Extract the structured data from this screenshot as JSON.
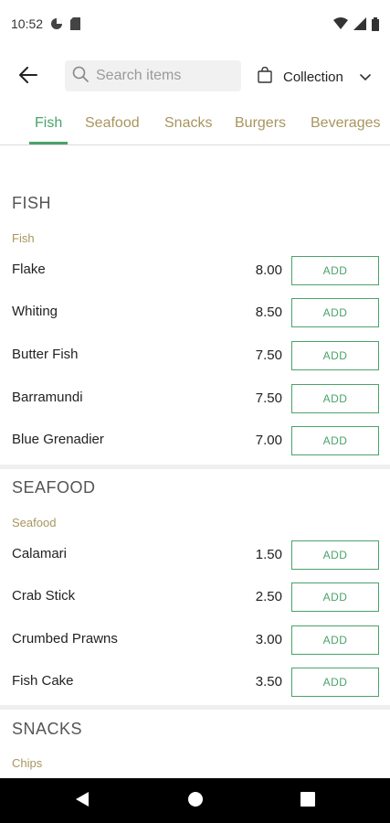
{
  "status_bar": {
    "time": "10:52",
    "icons": [
      "data-saver-icon",
      "sd-card-icon",
      "wifi-icon",
      "signal-icon",
      "battery-icon"
    ]
  },
  "header": {
    "back_icon": "arrow-left-icon",
    "search_placeholder": "Search items",
    "search_value": "",
    "collection_label": "Collection",
    "collection_icon": "shopping-bag-icon",
    "dropdown_icon": "chevron-down-icon"
  },
  "tabs": [
    {
      "label": "Fish",
      "active": true
    },
    {
      "label": "Seafood",
      "active": false
    },
    {
      "label": "Snacks",
      "active": false
    },
    {
      "label": "Burgers",
      "active": false
    },
    {
      "label": "Beverages",
      "active": false
    }
  ],
  "sections": [
    {
      "title": "FISH",
      "subtitle": "Fish",
      "items": [
        {
          "name": "Flake",
          "price": "8.00",
          "button": "ADD"
        },
        {
          "name": "Whiting",
          "price": "8.50",
          "button": "ADD"
        },
        {
          "name": "Butter Fish",
          "price": "7.50",
          "button": "ADD"
        },
        {
          "name": "Barramundi",
          "price": "7.50",
          "button": "ADD"
        },
        {
          "name": "Blue Grenadier",
          "price": "7.00",
          "button": "ADD"
        }
      ]
    },
    {
      "title": "SEAFOOD",
      "subtitle": "Seafood",
      "items": [
        {
          "name": "Calamari",
          "price": "1.50",
          "button": "ADD"
        },
        {
          "name": "Crab Stick",
          "price": "2.50",
          "button": "ADD"
        },
        {
          "name": "Crumbed Prawns",
          "price": "3.00",
          "button": "ADD"
        },
        {
          "name": "Fish Cake",
          "price": "3.50",
          "button": "ADD"
        }
      ]
    },
    {
      "title": "SNACKS",
      "subtitle": "Chips",
      "items": []
    }
  ],
  "colors": {
    "accent": "#4aa36a",
    "subtitle": "#a8955f",
    "tab_inactive": "#a8955f"
  },
  "nav_bar": {
    "icons": [
      "back-triangle-icon",
      "home-circle-icon",
      "recents-square-icon"
    ]
  }
}
